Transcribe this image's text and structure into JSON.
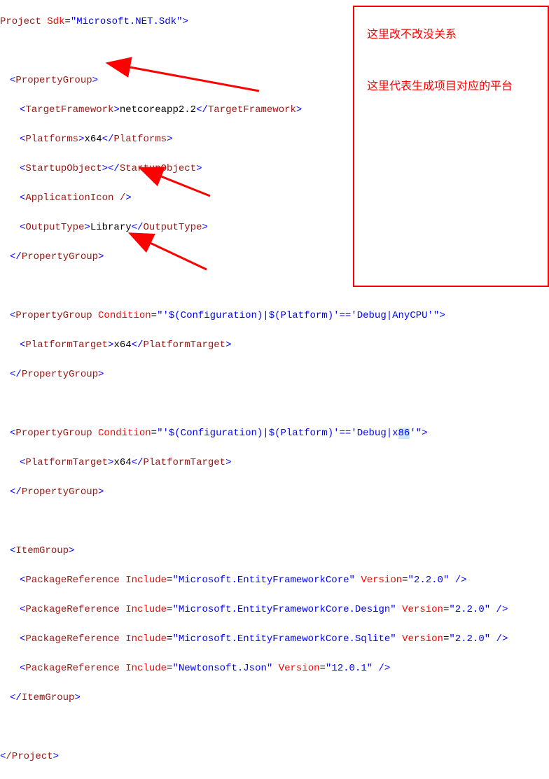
{
  "lines": {
    "project_open_1": "Project ",
    "project_sdk_attr": "Sdk",
    "project_sdk_val": "\"Microsoft.NET.Sdk\"",
    "pg_open": "PropertyGroup",
    "tf_open": "TargetFramework",
    "tf_val": "netcoreapp2.2",
    "platforms_open": "Platforms",
    "platforms_val": "x64",
    "startup_open": "StartupObject",
    "appicon": "ApplicationIcon /",
    "output_open": "OutputType",
    "output_val": "Library",
    "pg_cond_attr": "Condition",
    "pg_cond_val1": "\"'$(Configuration)|$(Platform)'=='Debug|AnyCPU'\"",
    "pg_cond_val2_a": "\"'$(Configuration)|$(Platform)'=='Debug|x",
    "pg_cond_val2_sel": "86",
    "pg_cond_val2_b": "'\"",
    "pt_open": "PlatformTarget",
    "pt_val": "x64",
    "ig_open": "ItemGroup",
    "pr_open": "PackageReference ",
    "inc_attr": "Include",
    "ver_attr": "Version",
    "pr1_inc": "\"Microsoft.EntityFrameworkCore\"",
    "pr1_ver": "\"2.2.0\"",
    "pr2_inc": "\"Microsoft.EntityFrameworkCore.Design\"",
    "pr2_ver": "\"2.2.0\"",
    "pr3_inc": "\"Microsoft.EntityFrameworkCore.Sqlite\"",
    "pr3_ver": "\"2.2.0\"",
    "pr4_inc": "\"Newtonsoft.Json\"",
    "pr4_ver": "\"12.0.1\"",
    "project_close": "/Project"
  },
  "callout": {
    "line1": "这里改不改没关系",
    "line2": "这里代表生成项目对应的平台"
  }
}
